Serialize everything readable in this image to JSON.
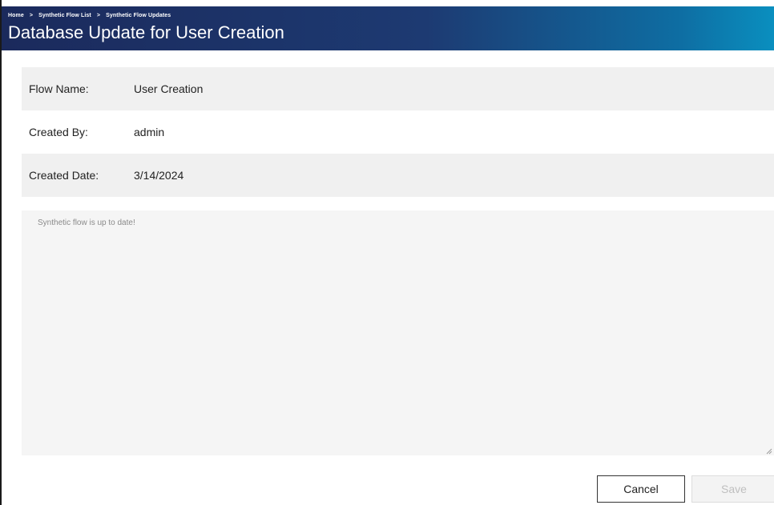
{
  "header": {
    "breadcrumb": [
      "Home",
      "Synthetic Flow List",
      "Synthetic Flow Updates"
    ],
    "breadcrumb_separator": ">",
    "title": "Database Update for User Creation",
    "gradient_colors": [
      "#1b2a5c",
      "#1d3a72",
      "#0e6ea3",
      "#0a8fbf"
    ]
  },
  "details": {
    "flow_name_label": "Flow Name:",
    "flow_name_value": "User Creation",
    "created_by_label": "Created By:",
    "created_by_value": "admin",
    "created_date_label": "Created Date:",
    "created_date_value": "3/14/2024"
  },
  "notes": {
    "placeholder": "Synthetic flow is up to date!"
  },
  "actions": {
    "cancel_label": "Cancel",
    "save_label": "Save",
    "save_enabled": false
  }
}
